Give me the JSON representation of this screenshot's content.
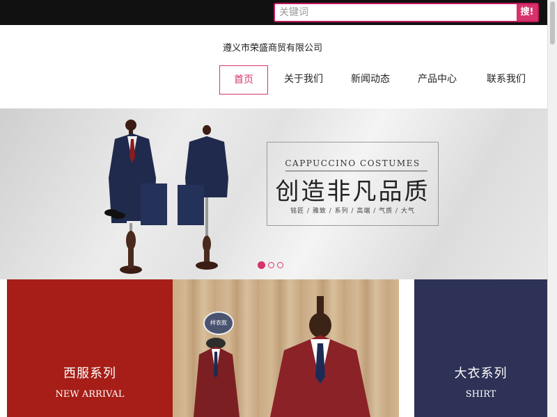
{
  "header": {
    "search": {
      "placeholder": "关键词",
      "value": "",
      "button_label": "搜!"
    },
    "company_name": "遵义市荣盛商贸有限公司"
  },
  "nav": {
    "items": [
      {
        "label": "首页",
        "active": true
      },
      {
        "label": "关于我们",
        "active": false
      },
      {
        "label": "新闻动态",
        "active": false
      },
      {
        "label": "产品中心",
        "active": false
      },
      {
        "label": "联系我们",
        "active": false
      }
    ]
  },
  "banner": {
    "title_en": "CAPPUCCINO COSTUMES",
    "title_cn": "创造非凡品质",
    "subtitle": "铭匠 / 雅致 / 系列 / 高端 / 气质 / 大气",
    "slides_total": 3,
    "active_slide": 1
  },
  "categories": [
    {
      "title": "西服系列",
      "subtitle": "NEW ARRIVAL",
      "color": "#a61e17"
    },
    {
      "badge": "样衣款"
    },
    {
      "title": "大衣系列",
      "subtitle": "SHIRT",
      "color": "#2d3256"
    }
  ],
  "colors": {
    "accent": "#d6336c",
    "topbar": "#111111"
  }
}
